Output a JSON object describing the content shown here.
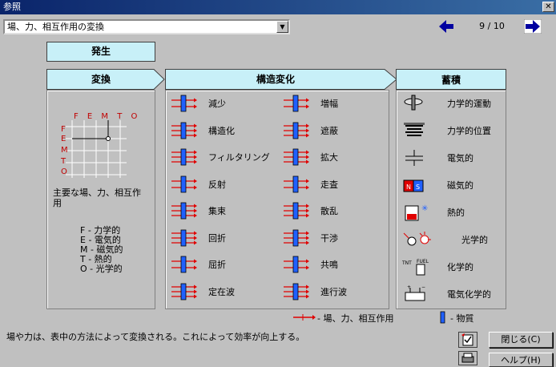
{
  "window": {
    "title": "参照"
  },
  "topic_select": {
    "value": "場、力、相互作用の変換"
  },
  "pager": {
    "text": "9 / 10"
  },
  "sections": {
    "hassei": "発生",
    "henkan": "変換",
    "kozo": "構造変化",
    "chikuseki": "蓄積"
  },
  "grid": {
    "top_labels": "F E M T O",
    "side_labels": [
      "F",
      "E",
      "M",
      "T",
      "O"
    ],
    "caption": "主要な場、力、相互作用",
    "legend": [
      "F - 力学的",
      "E - 電気的",
      "M - 磁気的",
      "T - 熱的",
      "O - 光学的"
    ]
  },
  "structure_left": [
    "減少",
    "構造化",
    "フィルタリング",
    "反射",
    "集束",
    "回折",
    "屈折",
    "定在波"
  ],
  "structure_right": [
    "増幅",
    "遮蔽",
    "拡大",
    "走査",
    "散乱",
    "干渉",
    "共鳴",
    "進行波"
  ],
  "storage": [
    "力学的運動",
    "力学的位置",
    "電気的",
    "磁気的",
    "熱的",
    "光学的",
    "化学的",
    "電気化学的"
  ],
  "storage_icon_text": {
    "magnet_n": "N",
    "magnet_s": "S",
    "tnt": "TNT",
    "fuel": "FUEL"
  },
  "bottom_legend": {
    "field": "- 場、力、相互作用",
    "substance": "- 物質"
  },
  "status_text": "場や力は、表中の方法によって変換される。これによって効率が向上する。",
  "buttons": {
    "close": "閉じる(C)",
    "help": "ヘルプ(H)"
  },
  "colors": {
    "header_bg": "#c8f0f8",
    "arrow_red": "#e00000",
    "substance_blue": "#2060ff",
    "nav_blue": "#0000a0"
  }
}
